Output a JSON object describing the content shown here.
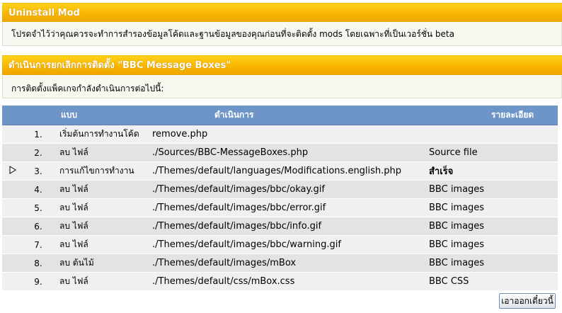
{
  "uninstall_header": {
    "title": "Uninstall Mod"
  },
  "warning": {
    "text": "โปรดจำไว้ว่าคุณควรจะทำการสำรองข้อมูลโค้ดและฐานข้อมูลของคุณก่อนที่จะติดตั้ง mods โดยเฉพาะที่เป็นเวอร์ชั่น beta"
  },
  "process_header": {
    "title": "ดำเนินการยกเลิกการติดตั้ง \"BBC Message Boxes\""
  },
  "process_info": {
    "text": "การติดตั้งแพ็คเกจกำลังดำเนินการต่อไปนี้:"
  },
  "table": {
    "columns": {
      "type": "แบบ",
      "action": "ดำเนินการ",
      "details": "รายละเอียด"
    },
    "rows": [
      {
        "num": "1.",
        "type": "เริ่มต้นการทำงานโค้ด",
        "action": "remove.php",
        "details": "",
        "bold": false,
        "current": false
      },
      {
        "num": "2.",
        "type": "ลบ ไฟล์",
        "action": "./Sources/BBC-MessageBoxes.php",
        "details": "Source file",
        "bold": false,
        "current": false
      },
      {
        "num": "3.",
        "type": "การแก้ไขการทำงาน",
        "action": "./Themes/default/languages/Modifications.english.php",
        "details": "สำเร็จ",
        "bold": true,
        "current": true
      },
      {
        "num": "4.",
        "type": "ลบ ไฟล์",
        "action": "./Themes/default/images/bbc/okay.gif",
        "details": "BBC images",
        "bold": false,
        "current": false
      },
      {
        "num": "5.",
        "type": "ลบ ไฟล์",
        "action": "./Themes/default/images/bbc/error.gif",
        "details": "BBC images",
        "bold": false,
        "current": false
      },
      {
        "num": "6.",
        "type": "ลบ ไฟล์",
        "action": "./Themes/default/images/bbc/info.gif",
        "details": "BBC images",
        "bold": false,
        "current": false
      },
      {
        "num": "7.",
        "type": "ลบ ไฟล์",
        "action": "./Themes/default/images/bbc/warning.gif",
        "details": "BBC images",
        "bold": false,
        "current": false
      },
      {
        "num": "8.",
        "type": "ลบ ต้นไม้",
        "action": "./Themes/default/images/mBox",
        "details": "BBC images",
        "bold": false,
        "current": false
      },
      {
        "num": "9.",
        "type": "ลบ ไฟล์",
        "action": "./Themes/default/css/mBox.css",
        "details": "BBC CSS",
        "bold": false,
        "current": false
      }
    ]
  },
  "submit_button": {
    "label": "เอาออกเดี๋ยวนี้"
  },
  "colors": {
    "header_gold": "#f8b500",
    "table_header_blue": "#6d95c8"
  }
}
